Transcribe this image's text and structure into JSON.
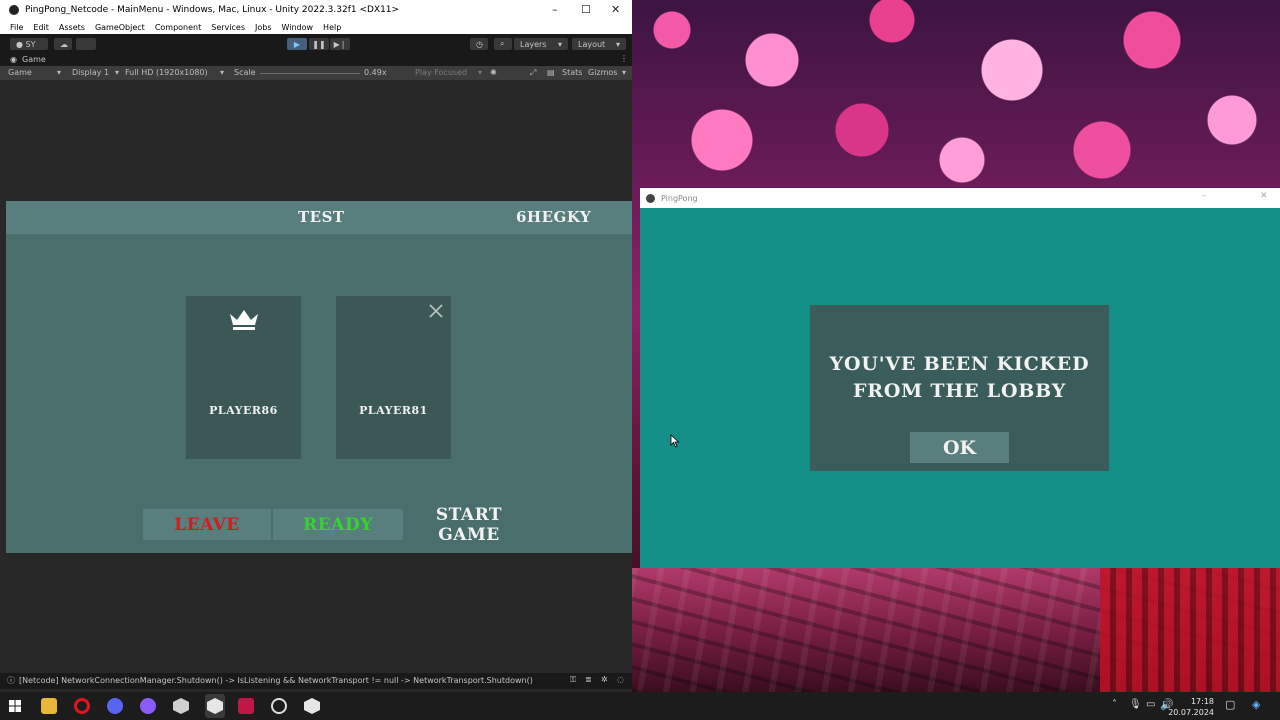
{
  "unity": {
    "title": "PingPong_Netcode - MainMenu - Windows, Mac, Linux - Unity 2022.3.32f1 <DX11>",
    "menu": [
      "File",
      "Edit",
      "Assets",
      "GameObject",
      "Component",
      "Services",
      "Jobs",
      "Window",
      "Help"
    ],
    "account": "SY",
    "layers_label": "Layers",
    "layout_label": "Layout",
    "game_tab": "Game",
    "game_dropdown": "Game",
    "display": "Display 1",
    "resolution": "Full HD (1920x1080)",
    "scale_label": "Scale",
    "scale_value": "0.49x",
    "play_focused": "Play Focused",
    "stats": "Stats",
    "gizmos": "Gizmos",
    "console_message": "[Netcode] NetworkConnectionManager.Shutdown() -> IsListening && NetworkTransport != null -> NetworkTransport.Shutdown()"
  },
  "lobby": {
    "lobby_name": "TEST",
    "lobby_code": "6HEGKY",
    "players": [
      {
        "name": "PLAYER86",
        "icon": "crown-icon"
      },
      {
        "name": "PLAYER81",
        "icon": "close-icon"
      }
    ],
    "leave_label": "LEAVE",
    "ready_label": "READY",
    "start_label": "START GAME",
    "leave_color": "#d01e1e",
    "ready_color": "#33d62a"
  },
  "pingpong": {
    "title": "PingPong",
    "message": "YOU'VE BEEN KICKED\nFROM THE LOBBY",
    "ok_label": "OK",
    "background_color": "#148f87"
  },
  "taskbar": {
    "time": "17:18",
    "date": "20.07.2024"
  }
}
